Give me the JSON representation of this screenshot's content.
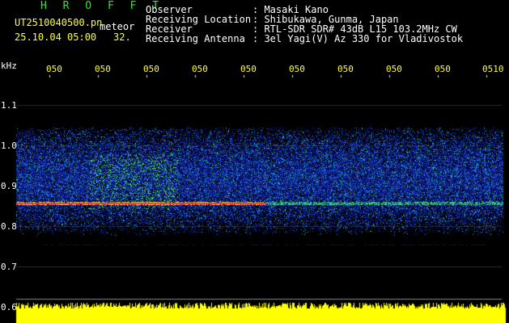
{
  "app": {
    "title": "H R O F F T"
  },
  "file": {
    "name": "UT2510040500.pn",
    "tag": "meteor",
    "datetime": "25.10.04 05:00",
    "count": "32."
  },
  "info": [
    {
      "label": "Observer",
      "value": ": Masaki Kano"
    },
    {
      "label": "Receiving Location",
      "value": ": Shibukawa, Gunma, Japan"
    },
    {
      "label": "Receiver",
      "value": ": RTL-SDR SDR# 43dB L15 103.2MHz CW"
    },
    {
      "label": "Receiving Antenna",
      "value": ": 3el Yagi(V) Az 330 for Vladivostok"
    }
  ],
  "axis": {
    "unit": "kHz",
    "time_ticks": [
      "050",
      "050",
      "050",
      "050",
      "050",
      "050",
      "050",
      "050",
      "050",
      "0510"
    ],
    "freq_ticks": [
      "1.1",
      "1.0",
      "0.9",
      "0.8",
      "0.7",
      "0.6"
    ]
  },
  "colors": {
    "background": "#000000",
    "title": "#2ee82e",
    "ticks": "#ffff33",
    "echo_line": "#ff3030",
    "level_bar": "#ffff00"
  }
}
